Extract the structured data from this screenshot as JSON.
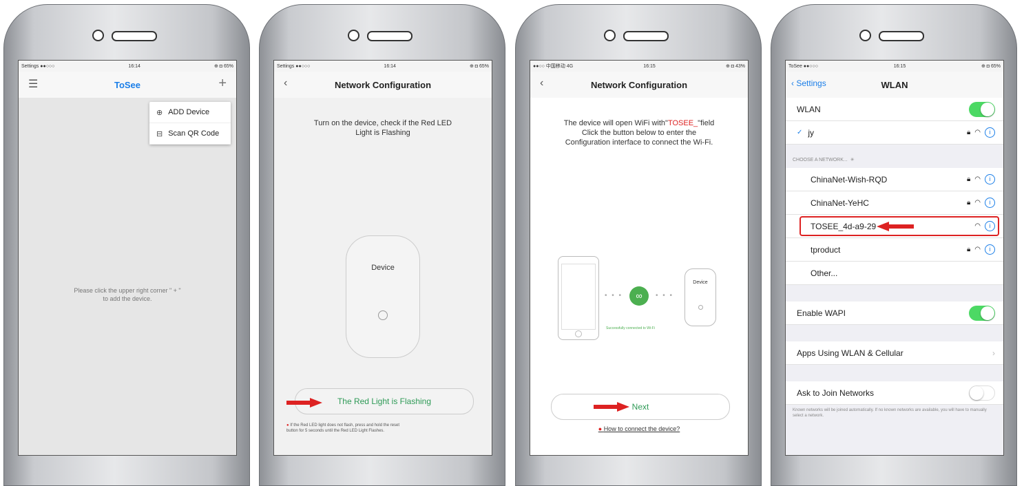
{
  "colors": {
    "accent_blue": "#1a7ee8",
    "success_green": "#2e9a56",
    "toggle_green": "#4cd964",
    "arrow_red": "#d22222"
  },
  "phone1": {
    "status": {
      "left": "Settings ●●○○○",
      "time": "16:14",
      "right": "⊕ ◘ 65%"
    },
    "title": "ToSee",
    "menu": [
      {
        "icon": "add-circle-icon",
        "label": "ADD Device"
      },
      {
        "icon": "scan-icon",
        "label": "Scan QR Code"
      }
    ],
    "hint_line1": "Please click the upper right corner  \" + \"",
    "hint_line2": "to add the device."
  },
  "phone2": {
    "status": {
      "left": "Settings ●●○○○",
      "time": "16:14",
      "right": "⊕ ◘ 65%"
    },
    "title": "Network Configuration",
    "instruction_line1": "Turn on the device, check if the Red LED",
    "instruction_line2": "Light is Flashing",
    "device_label": "Device",
    "button_label": "The Red Light is Flashing",
    "note_line1": "If the Red LED light does not flash, press and hold the reset",
    "note_line2": "button for 5 seconds until the Red LED Light Flashes."
  },
  "phone3": {
    "status": {
      "left": "●●○○ 中国移动 4G",
      "time": "16:15",
      "right": "⊕ ◘ 43%"
    },
    "title": "Network Configuration",
    "instruction_prefix": "The device will open WiFi with\"",
    "instruction_highlight": "TOSEE_",
    "instruction_suffix": "\"field",
    "instruction_line2": "Click the button below to enter the",
    "instruction_line3": "Configuration interface to connect the Wi-Fi.",
    "device_label": "Device",
    "success_text": "Successfully connected to Wi-Fi",
    "button_label": "Next",
    "help_link": "How to connect the device?"
  },
  "phone4": {
    "status": {
      "left": "ToSee ●●○○○",
      "time": "16:15",
      "right": "⊕ ◘ 65%"
    },
    "back_label": "Settings",
    "title": "WLAN",
    "wlan_label": "WLAN",
    "wlan_on": true,
    "connected_network": "jy",
    "choose_header": "CHOOSE A NETWORK...",
    "networks": [
      {
        "name": "ChinaNet-Wish-RQD",
        "locked": true
      },
      {
        "name": "ChinaNet-YeHC",
        "locked": true
      },
      {
        "name": "TOSEE_4d-a9-29",
        "locked": false
      },
      {
        "name": "tproduct",
        "locked": true
      }
    ],
    "other_label": "Other...",
    "enable_wapi_label": "Enable WAPI",
    "enable_wapi_on": true,
    "apps_label": "Apps Using WLAN & Cellular",
    "ask_join_label": "Ask to Join Networks",
    "ask_join_on": false,
    "footnote": "Known networks will be joined automatically. If no known networks are available, you will have to manually select a network."
  }
}
